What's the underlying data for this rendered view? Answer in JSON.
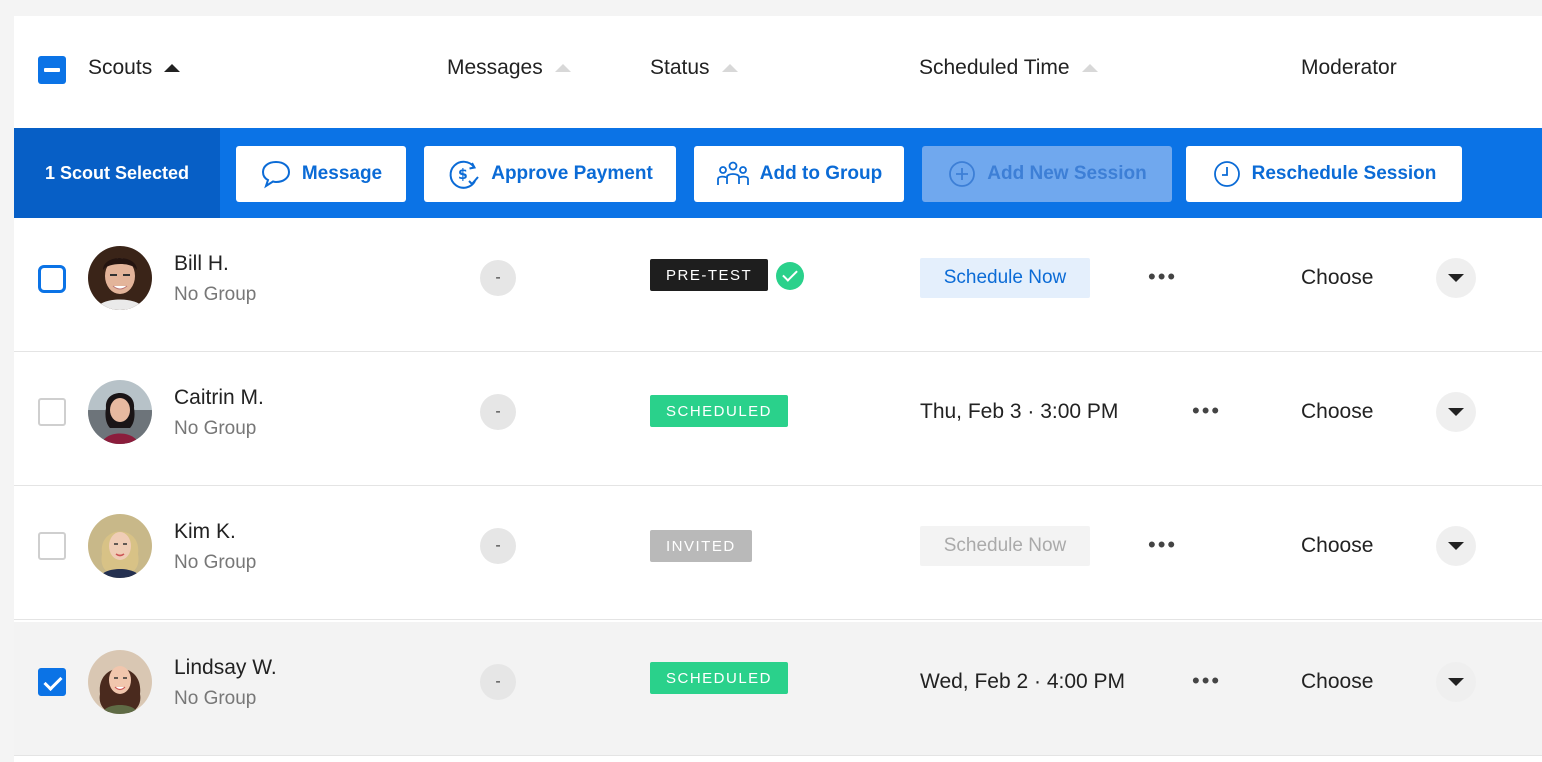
{
  "header": {
    "scouts": "Scouts",
    "messages": "Messages",
    "status": "Status",
    "scheduled_time": "Scheduled Time",
    "moderator": "Moderator"
  },
  "action_bar": {
    "selected_count": "1 Scout Selected",
    "message": "Message",
    "approve_payment": "Approve Payment",
    "add_to_group": "Add to Group",
    "add_new_session": "Add New Session",
    "reschedule_session": "Reschedule Session"
  },
  "rows": [
    {
      "name": "Bill H.",
      "group": "No Group",
      "messages": "-",
      "status": "PRE-TEST",
      "schedule_button": "Schedule Now",
      "moderator": "Choose"
    },
    {
      "name": "Caitrin M.",
      "group": "No Group",
      "messages": "-",
      "status": "SCHEDULED",
      "scheduled_time": "Thu, Feb 3 · 3:00 PM",
      "moderator": "Choose"
    },
    {
      "name": "Kim K.",
      "group": "No Group",
      "messages": "-",
      "status": "INVITED",
      "schedule_button": "Schedule Now",
      "moderator": "Choose"
    },
    {
      "name": "Lindsay W.",
      "group": "No Group",
      "messages": "-",
      "status": "SCHEDULED",
      "scheduled_time": "Wed, Feb 2 · 4:00 PM",
      "moderator": "Choose"
    }
  ],
  "colors": {
    "accent": "#0b73e6",
    "scheduled": "#2ad18b",
    "pretest": "#1e1e1e",
    "invited": "#b9b9b9"
  }
}
